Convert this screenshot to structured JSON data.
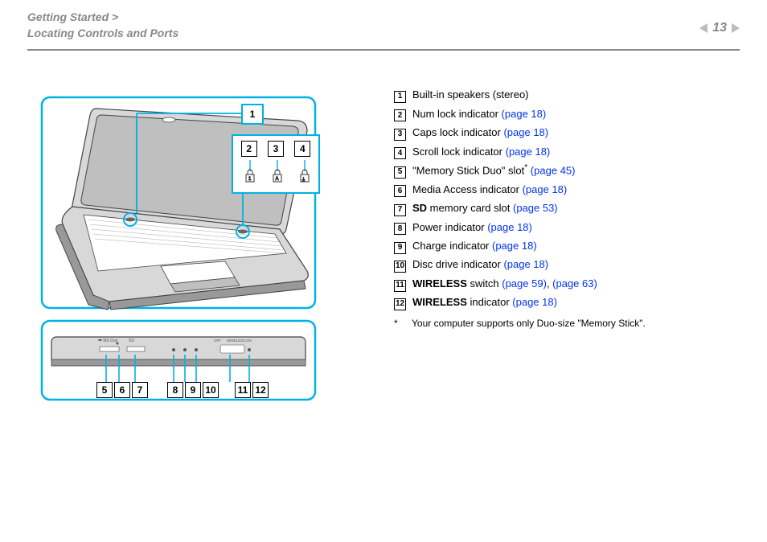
{
  "header": {
    "crumb1": "Getting Started >",
    "crumb2": "Locating Controls and Ports",
    "page_number": "13"
  },
  "legend": {
    "items": [
      {
        "num": "1",
        "pre": "",
        "bold": "",
        "text": "Built-in speakers (stereo)",
        "links": []
      },
      {
        "num": "2",
        "pre": "",
        "bold": "",
        "text": "Num lock indicator ",
        "links": [
          "(page 18)"
        ]
      },
      {
        "num": "3",
        "pre": "",
        "bold": "",
        "text": "Caps lock indicator ",
        "links": [
          "(page 18)"
        ]
      },
      {
        "num": "4",
        "pre": "",
        "bold": "",
        "text": "Scroll lock indicator ",
        "links": [
          "(page 18)"
        ]
      },
      {
        "num": "5",
        "pre": "",
        "bold": "",
        "text": "\"Memory Stick Duo\" slot",
        "sup": "*",
        "post": " ",
        "links": [
          "(page 45)"
        ]
      },
      {
        "num": "6",
        "pre": "",
        "bold": "",
        "text": "Media Access indicator ",
        "links": [
          "(page 18)"
        ]
      },
      {
        "num": "7",
        "pre": "",
        "bold": "SD",
        "text": " memory card slot ",
        "links": [
          "(page 53)"
        ]
      },
      {
        "num": "8",
        "pre": "",
        "bold": "",
        "text": "Power indicator ",
        "links": [
          "(page 18)"
        ]
      },
      {
        "num": "9",
        "pre": "",
        "bold": "",
        "text": "Charge indicator ",
        "links": [
          "(page 18)"
        ]
      },
      {
        "num": "10",
        "pre": "",
        "bold": "",
        "text": "Disc drive indicator ",
        "links": [
          "(page 18)"
        ]
      },
      {
        "num": "11",
        "pre": "",
        "bold": "WIRELESS",
        "text": " switch ",
        "links": [
          "(page 59)",
          ", ",
          "(page 63)"
        ]
      },
      {
        "num": "12",
        "pre": "",
        "bold": "WIRELESS",
        "text": " indicator ",
        "links": [
          "(page 18)"
        ]
      }
    ],
    "footnote_mark": "*",
    "footnote_text": "Your computer supports only Duo-size \"Memory Stick\"."
  },
  "diagram": {
    "callout_1": "1",
    "callout_row1": [
      "2",
      "3",
      "4"
    ],
    "callout_row2": [
      "5",
      "6",
      "7",
      "8",
      "9",
      "10",
      "11",
      "12"
    ],
    "port_labels": {
      "msduo": "MS Duo",
      "sd": "SD",
      "wireless": "WIRELESS",
      "on": "ON",
      "off": "OFF"
    }
  }
}
